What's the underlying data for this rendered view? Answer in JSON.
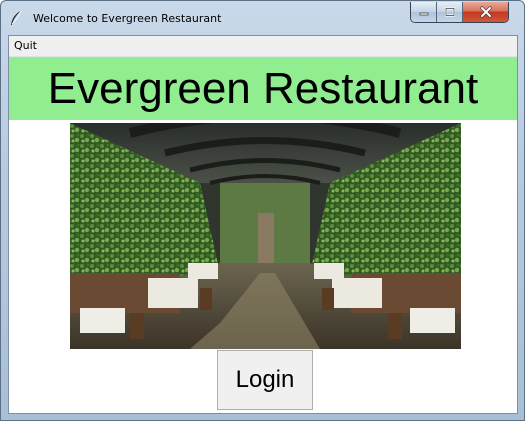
{
  "window": {
    "title": "Welcome to Evergreen Restaurant",
    "controls": [
      "minimize",
      "maximize",
      "close"
    ]
  },
  "menu": {
    "items": [
      {
        "label": "Quit"
      }
    ]
  },
  "banner": {
    "text": "Evergreen Restaurant",
    "background": "#90ee90"
  },
  "image": {
    "description_icon": "restaurant-interior-photo"
  },
  "login": {
    "label": "Login"
  },
  "colors": {
    "banner_bg": "#90ee90",
    "close_button": "#c2391e",
    "titlebar": "#b7cbe0"
  }
}
